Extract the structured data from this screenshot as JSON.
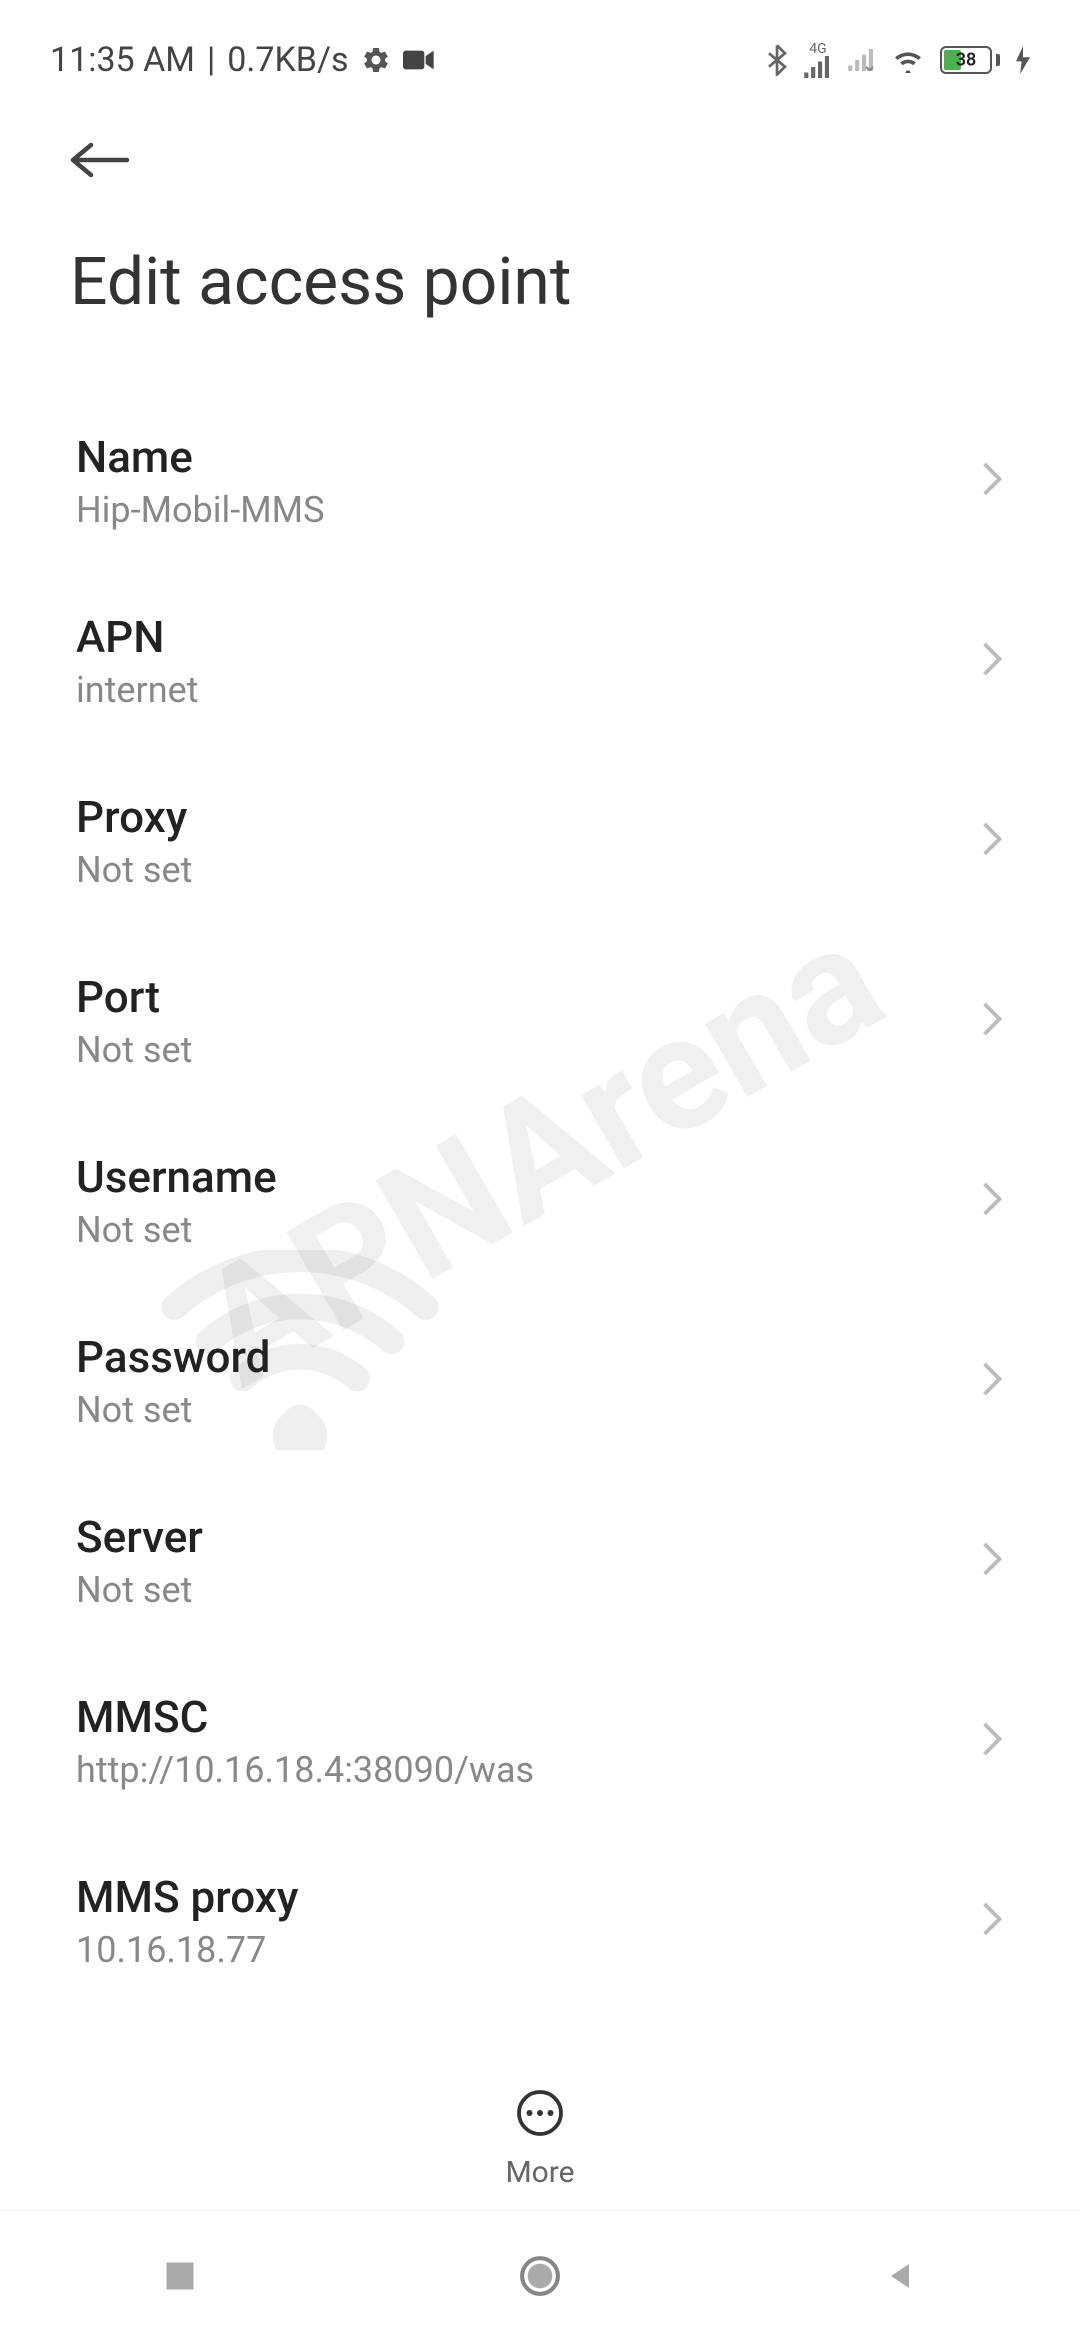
{
  "status_bar": {
    "time": "11:35 AM",
    "separator": "|",
    "data_rate": "0.7KB/s",
    "battery_percent": "38",
    "network_label": "4G"
  },
  "header": {
    "title": "Edit access point"
  },
  "settings": [
    {
      "label": "Name",
      "value": "Hip-Mobil-MMS"
    },
    {
      "label": "APN",
      "value": "internet"
    },
    {
      "label": "Proxy",
      "value": "Not set"
    },
    {
      "label": "Port",
      "value": "Not set"
    },
    {
      "label": "Username",
      "value": "Not set"
    },
    {
      "label": "Password",
      "value": "Not set"
    },
    {
      "label": "Server",
      "value": "Not set"
    },
    {
      "label": "MMSC",
      "value": "http://10.16.18.4:38090/was"
    },
    {
      "label": "MMS proxy",
      "value": "10.16.18.77"
    }
  ],
  "bottom": {
    "more_label": "More"
  },
  "watermark": "APNArena"
}
